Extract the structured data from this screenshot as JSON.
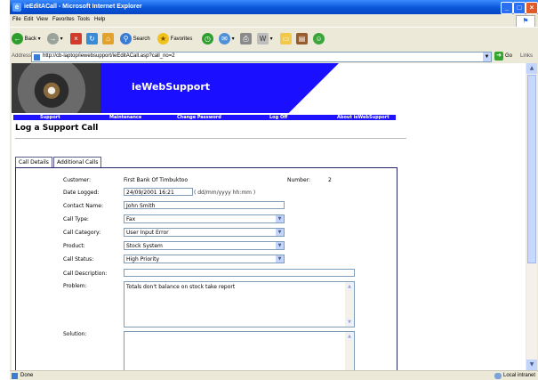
{
  "window": {
    "title": "ieEditACall - Microsoft Internet Explorer",
    "min": "_",
    "max": "□",
    "close": "×"
  },
  "menu": [
    "File",
    "Edit",
    "View",
    "Favorites",
    "Tools",
    "Help"
  ],
  "toolbar": {
    "back": "Back",
    "search": "Search",
    "favorites": "Favorites"
  },
  "address": {
    "label": "Address",
    "url": "http://cb-laptop/iewebsupport/ieEditACall.asp?call_no=2",
    "go": "Go",
    "links": "Links"
  },
  "banner": {
    "brand": "ieWebSupport"
  },
  "nav": [
    "Support",
    "Maintenance",
    "Change Password",
    "Log Off",
    "About ieWebSupport"
  ],
  "page": {
    "title": "Log a Support Call"
  },
  "tabs": [
    "Call Details",
    "Additional Calls"
  ],
  "form": {
    "customer_label": "Customer:",
    "customer_value": "First Bank Of Timbuktoo",
    "number_label": "Number:",
    "number_value": "2",
    "date_label": "Date Logged:",
    "date_value": "24/09/2001 16:21",
    "date_hint": "( dd/mm/yyyy hh:mm )",
    "contact_label": "Contact Name:",
    "contact_value": "John Smith",
    "calltype_label": "Call Type:",
    "calltype_value": "Fax",
    "category_label": "Call Category:",
    "category_value": "User Input Error",
    "product_label": "Product:",
    "product_value": "Stock System",
    "status_label": "Call Status:",
    "status_value": "High Priority",
    "description_label": "Call Description:",
    "description_value": "",
    "problem_label": "Problem:",
    "problem_value": "Totals don't balance on stock take report",
    "solution_label": "Solution:",
    "solution_value": ""
  },
  "status": {
    "text": "Done",
    "zone": "Local intranet"
  }
}
